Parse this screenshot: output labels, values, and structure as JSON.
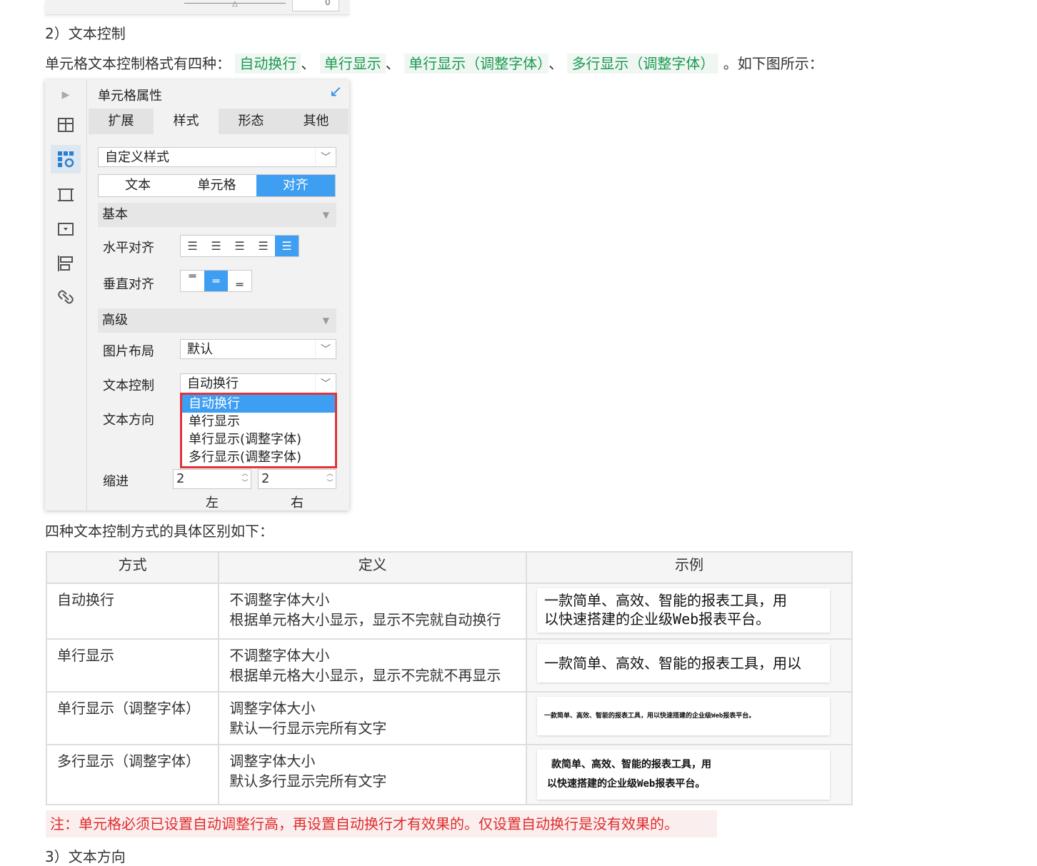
{
  "top_fragment": {
    "spin_value": "0"
  },
  "section2_title": "2）文本控制",
  "intro": {
    "prefix": "单元格文本控制格式有四种：",
    "tags": [
      "自动换行",
      "单行显示",
      "单行显示（调整字体）",
      "多行显示（调整字体）"
    ],
    "sep": "、",
    "suffix": "。如下图所示："
  },
  "panel": {
    "title": "单元格属性",
    "tabs": [
      "扩展",
      "样式",
      "形态",
      "其他"
    ],
    "style_select": "自定义样式",
    "subtabs": [
      "文本",
      "单元格",
      "对齐"
    ],
    "basic_section": "基本",
    "h_align_label": "水平对齐",
    "v_align_label": "垂直对齐",
    "advanced_section": "高级",
    "image_layout_label": "图片布局",
    "image_layout_value": "默认",
    "text_control_label": "文本控制",
    "text_control_value": "自动换行",
    "text_direction_label": "文本方向",
    "dropdown_options": [
      "自动换行",
      "单行显示",
      "单行显示(调整字体)",
      "多行显示(调整字体)"
    ],
    "indent_label": "缩进",
    "indent_left": "2",
    "indent_right": "2",
    "left_label": "左",
    "right_label": "右"
  },
  "table_intro": "四种文本控制方式的具体区别如下：",
  "table": {
    "headers": [
      "方式",
      "定义",
      "示例"
    ],
    "rows": [
      {
        "mode": "自动换行",
        "def1": "不调整字体大小",
        "def2": "根据单元格大小显示，显示不完就自动换行",
        "ex1": "一款简单、高效、智能的报表工具，用",
        "ex2": "以快速搭建的企业级Web报表平台。"
      },
      {
        "mode": "单行显示",
        "def1": "不调整字体大小",
        "def2": "根据单元格大小显示，显示不完就不再显示",
        "ex1": "一款简单、高效、智能的报表工具，用以"
      },
      {
        "mode": "单行显示（调整字体）",
        "def1": "调整字体大小",
        "def2": "默认一行显示完所有文字",
        "ex1": "一款简单、高效、智能的报表工具，用以快速搭建的企业级Web报表平台。"
      },
      {
        "mode": "多行显示（调整字体）",
        "def1": "调整字体大小",
        "def2": "默认多行显示完所有文字",
        "ex1": "款简单、高效、智能的报表工具，用",
        "ex2": "以快速搭建的企业级Web报表平台。"
      }
    ]
  },
  "note": "注：单元格必须已设置自动调整行高，再设置自动换行才有效果的。仅设置自动换行是没有效果的。",
  "section3_title": "3）文本方向"
}
